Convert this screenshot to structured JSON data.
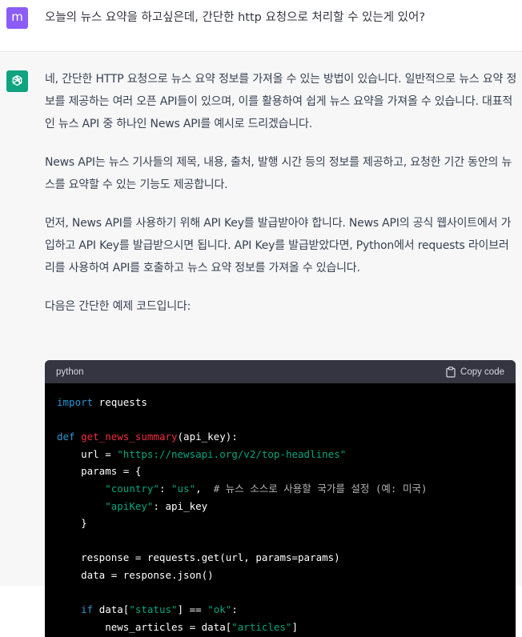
{
  "user": {
    "avatar_letter": "m",
    "message": "오늘의 뉴스 요약을 하고싶은데, 간단한 http 요청으로 처리할 수 있는게 있어?"
  },
  "assistant": {
    "paragraphs": [
      "네, 간단한 HTTP 요청으로 뉴스 요약 정보를 가져올 수 있는 방법이 있습니다. 일반적으로 뉴스 요약 정보를 제공하는 여러 오픈 API들이 있으며, 이를 활용하여 쉽게 뉴스 요약을 가져올 수 있습니다. 대표적인 뉴스 API 중 하나인 News API를 예시로 드리겠습니다.",
      "News API는 뉴스 기사들의 제목, 내용, 출처, 발행 시간 등의 정보를 제공하고, 요청한 기간 동안의 뉴스를 요약할 수 있는 기능도 제공합니다.",
      "먼저, News API를 사용하기 위해 API Key를 발급받아야 합니다. News API의 공식 웹사이트에서 가입하고 API Key를 발급받으시면 됩니다. API Key를 발급받았다면, Python에서 requests 라이브러리를 사용하여 API를 호출하고 뉴스 요약 정보를 가져올 수 있습니다.",
      "다음은 간단한 예제 코드입니다:"
    ]
  },
  "code": {
    "language": "python",
    "copy_label": "Copy code",
    "lines": [
      [
        {
          "t": "import",
          "c": "kw"
        },
        {
          "t": " requests"
        }
      ],
      [],
      [
        {
          "t": "def",
          "c": "kw"
        },
        {
          "t": " "
        },
        {
          "t": "get_news_summary",
          "c": "fn"
        },
        {
          "t": "(api_key):"
        }
      ],
      [
        {
          "t": "    url = "
        },
        {
          "t": "\"https://newsapi.org/v2/top-headlines\"",
          "c": "str"
        }
      ],
      [
        {
          "t": "    params = {"
        }
      ],
      [
        {
          "t": "        "
        },
        {
          "t": "\"country\"",
          "c": "str"
        },
        {
          "t": ": "
        },
        {
          "t": "\"us\"",
          "c": "str"
        },
        {
          "t": ",  "
        },
        {
          "t": "# 뉴스 소스로 사용할 국가를 설정 (예: 미국)",
          "c": "cm"
        }
      ],
      [
        {
          "t": "        "
        },
        {
          "t": "\"apiKey\"",
          "c": "str"
        },
        {
          "t": ": api_key"
        }
      ],
      [
        {
          "t": "    }"
        }
      ],
      [],
      [
        {
          "t": "    response = requests.get(url, params=params)"
        }
      ],
      [
        {
          "t": "    data = response.json()"
        }
      ],
      [],
      [
        {
          "t": "    "
        },
        {
          "t": "if",
          "c": "kw"
        },
        {
          "t": " data["
        },
        {
          "t": "\"status\"",
          "c": "str"
        },
        {
          "t": "] == "
        },
        {
          "t": "\"ok\"",
          "c": "str"
        },
        {
          "t": ":"
        }
      ],
      [
        {
          "t": "        news_articles = data["
        },
        {
          "t": "\"articles\"",
          "c": "str"
        },
        {
          "t": "]"
        }
      ]
    ]
  },
  "colors": {
    "user_avatar": "#8b5cf6",
    "bot_avatar": "#10a37f",
    "keyword": "#2e95d3",
    "function": "#f22c3d",
    "string": "#00a67d"
  }
}
